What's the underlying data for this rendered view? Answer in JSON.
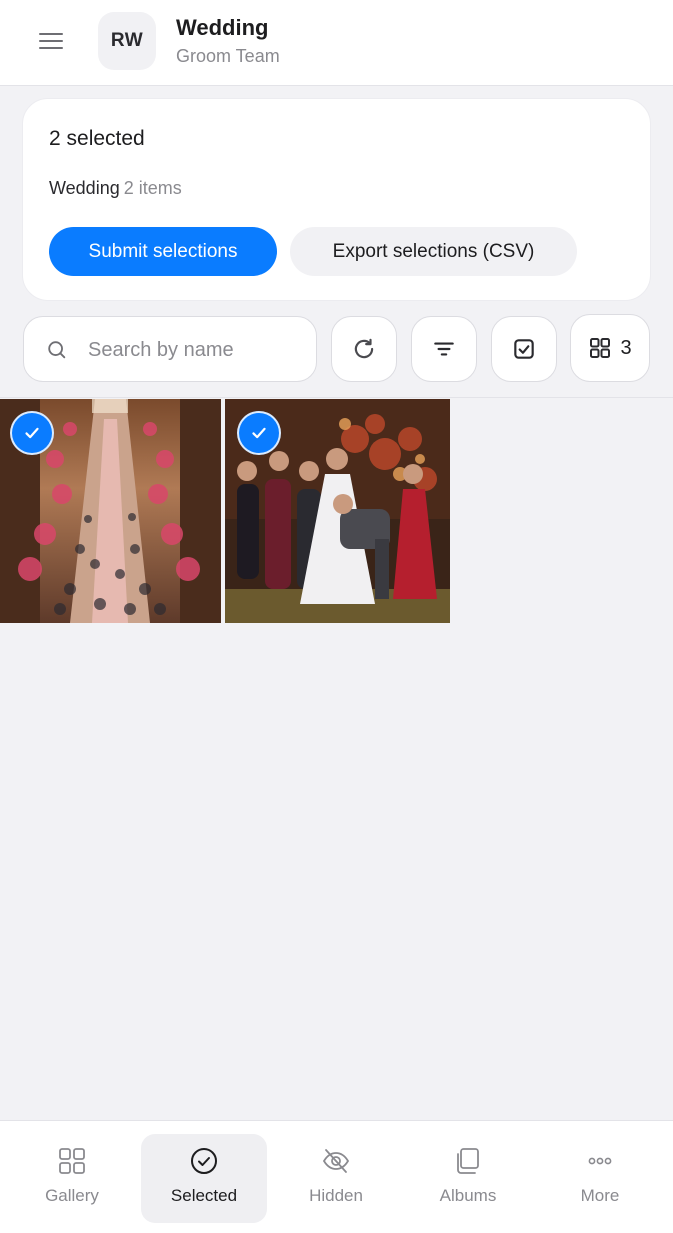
{
  "header": {
    "avatar_initials": "RW",
    "title": "Wedding",
    "subtitle": "Groom Team"
  },
  "selection": {
    "count_label": "2 selected",
    "group_name": "Wedding",
    "group_items": "2 items",
    "submit_label": "Submit selections",
    "export_label": "Export selections (CSV)"
  },
  "toolbar": {
    "search_placeholder": "Search by name",
    "search_value": "",
    "grid_columns": "3"
  },
  "photos": [
    {
      "description_icon": "wedding-procession-photo",
      "selected": true
    },
    {
      "description_icon": "wedding-party-photo",
      "selected": true
    }
  ],
  "bottom_nav": {
    "items": [
      {
        "label": "Gallery",
        "icon": "grid-icon",
        "active": false
      },
      {
        "label": "Selected",
        "icon": "check-circle-icon",
        "active": true
      },
      {
        "label": "Hidden",
        "icon": "eye-off-icon",
        "active": false
      },
      {
        "label": "Albums",
        "icon": "albums-icon",
        "active": false
      },
      {
        "label": "More",
        "icon": "more-icon",
        "active": false
      }
    ]
  },
  "colors": {
    "accent": "#0a7cff",
    "background": "#f2f2f5",
    "muted_text": "#8a8a8f"
  }
}
